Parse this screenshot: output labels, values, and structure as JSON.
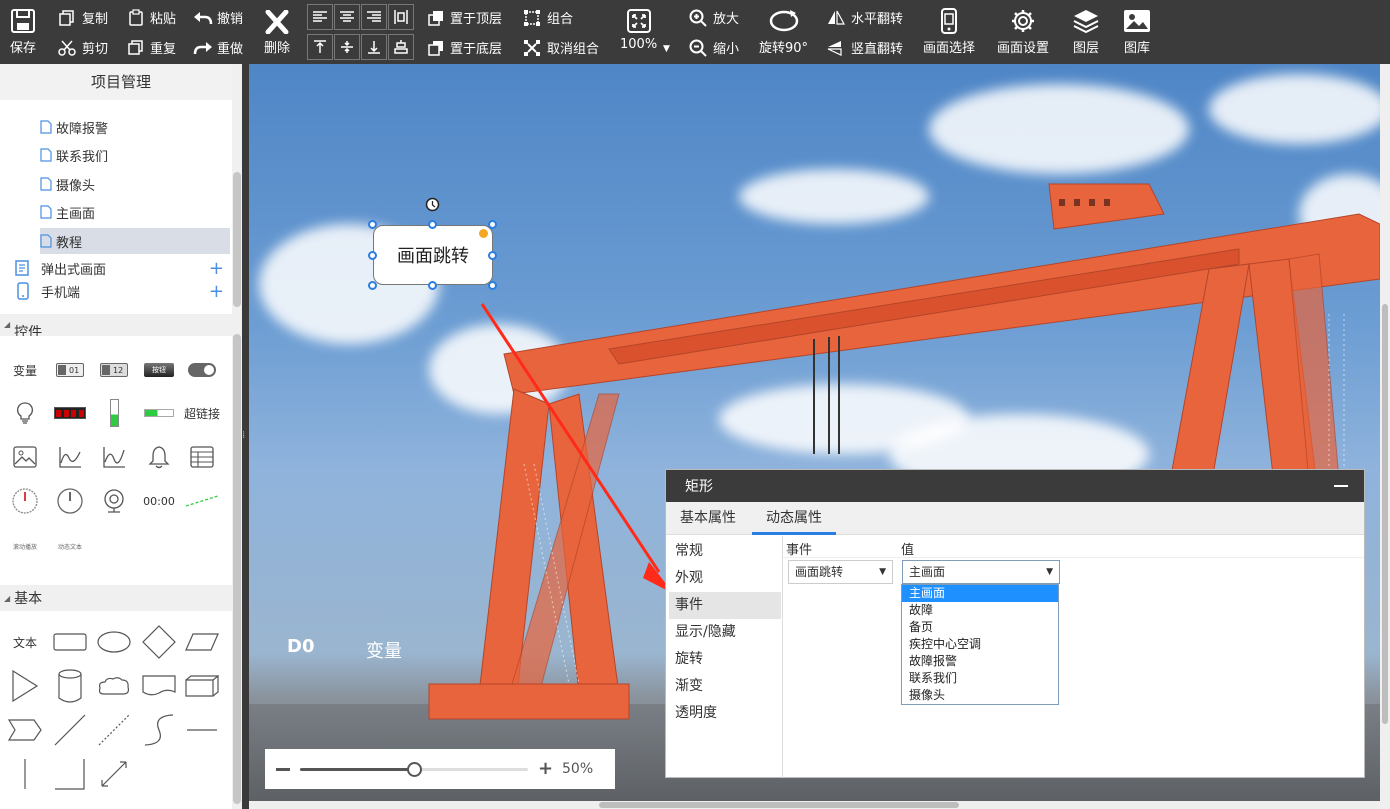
{
  "toolbar": {
    "save": "保存",
    "copy": "复制",
    "cut": "剪切",
    "paste": "粘贴",
    "duplicate": "重复",
    "undo": "撤销",
    "redo": "重做",
    "delete": "删除",
    "bring_top": "置于顶层",
    "send_bottom": "置于底层",
    "group": "组合",
    "ungroup": "取消组合",
    "zoom_value": "100%",
    "zoom_in": "放大",
    "zoom_out": "缩小",
    "rotate": "旋转90°",
    "flip_h": "水平翻转",
    "flip_v": "竖直翻转",
    "screen_select": "画面选择",
    "screen_settings": "画面设置",
    "layers": "图层",
    "gallery": "图库"
  },
  "left_panel": {
    "title": "项目管理",
    "pages": [
      "故障报警",
      "联系我们",
      "摄像头",
      "主画面",
      "教程"
    ],
    "selected_page": "教程",
    "groups": [
      {
        "label": "弹出式画面",
        "icon": "popup-icon"
      },
      {
        "label": "手机端",
        "icon": "phone-icon"
      }
    ],
    "controls_section": "控件",
    "controls_text": {
      "var": "变量",
      "link": "超链接",
      "time": "00:00",
      "scroll_text": "滚动播放",
      "dynamic_text": "动态文本"
    },
    "controls_badges": {
      "b1": "01",
      "b2": "12",
      "b3": "按钮"
    },
    "basic_section": "基本",
    "basic_text": "文本"
  },
  "canvas": {
    "widget_text": "画面跳转",
    "label_d0": "D0",
    "label_var": "变量",
    "zoom_percent": "50%",
    "zoom_level": 0.5
  },
  "property_panel": {
    "title": "矩形",
    "tabs": [
      "基本属性",
      "动态属性"
    ],
    "active_tab": "动态属性",
    "categories": [
      "常规",
      "外观",
      "事件",
      "显示/隐藏",
      "旋转",
      "渐变",
      "透明度"
    ],
    "active_category": "事件",
    "col_event": "事件",
    "col_value": "值",
    "event_value": "画面跳转",
    "selected_value": "主画面",
    "dropdown_options": [
      "主画面",
      "故障",
      "备页",
      "疾控中心空调",
      "故障报警",
      "联系我们",
      "摄像头"
    ]
  },
  "colors": {
    "toolbar_bg": "#3b3b3b",
    "accent": "#2a7de1",
    "arrow": "#ff2a1a",
    "crane": "#e8643c"
  }
}
